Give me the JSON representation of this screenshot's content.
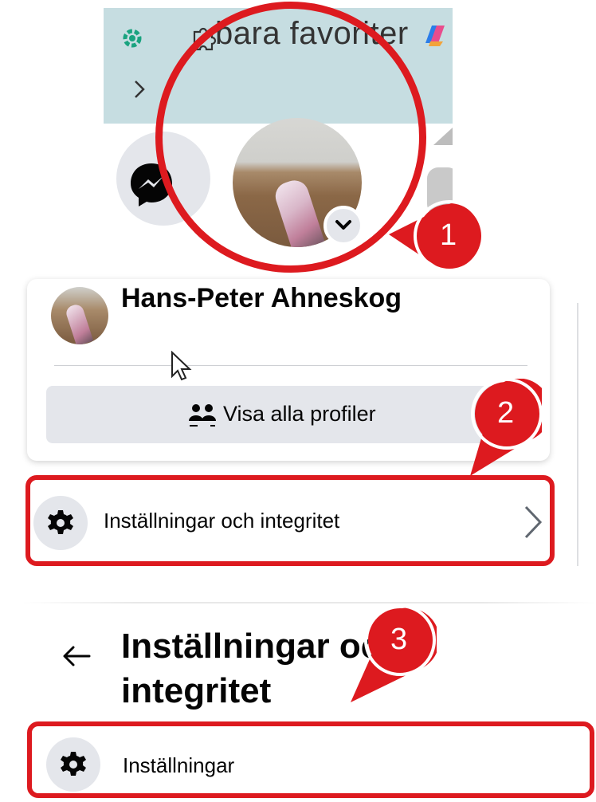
{
  "browser": {
    "bookmarks_text": "bara favoriter",
    "icons": [
      "chatgpt-icon",
      "extensions-icon",
      "copilot-icon",
      "chevron-right-icon"
    ]
  },
  "nav": {
    "icons": [
      "messenger-icon",
      "profile-avatar",
      "chevron-down-icon"
    ]
  },
  "profile_menu": {
    "profile_name": "Hans-Peter Ahneskog",
    "all_profiles_label": "Visa alla profiler",
    "settings_privacy_label": "Inställningar och integritet"
  },
  "settings_panel": {
    "heading": "Inställningar och integritet",
    "settings_label": "Inställningar"
  },
  "callouts": {
    "step1": "1",
    "step2": "2",
    "step3": "3",
    "color": "#dd1a1f"
  }
}
